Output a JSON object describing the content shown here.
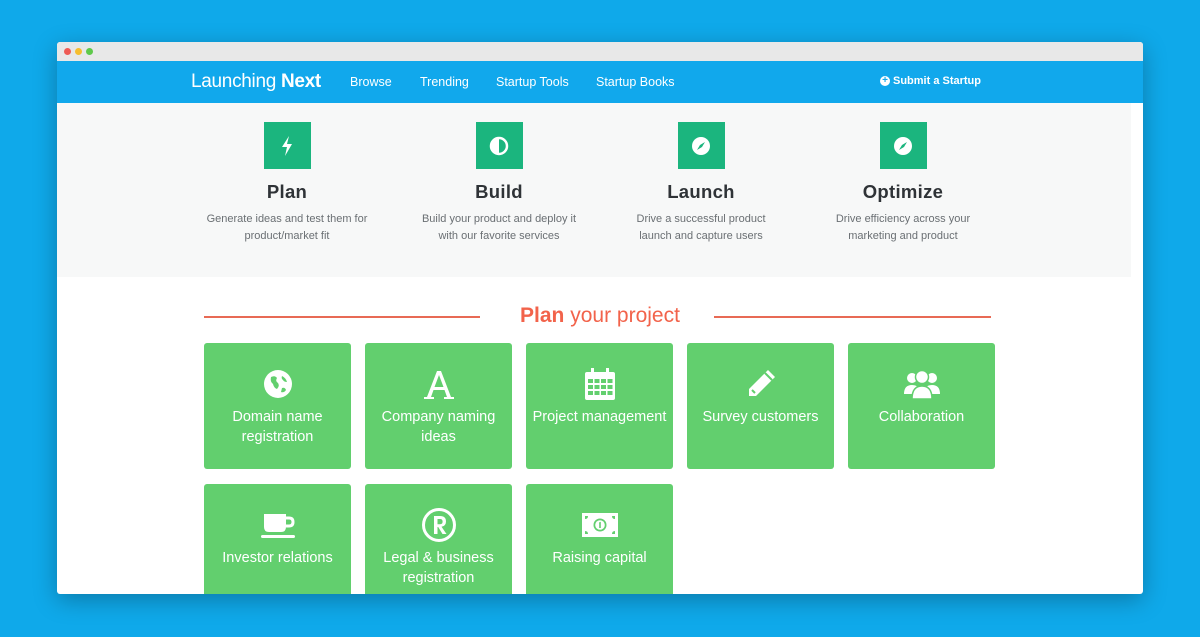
{
  "nav": {
    "logo_light": "Launching ",
    "logo_bold": "Next",
    "links": [
      "Browse",
      "Trending",
      "Startup Tools",
      "Startup Books"
    ],
    "submit": "Submit a Startup"
  },
  "phases": [
    {
      "title": "Plan",
      "desc_line1": "Generate ideas and test them for",
      "desc_line2": "product/market fit",
      "icon": "bolt-icon"
    },
    {
      "title": "Build",
      "desc_line1": "Build your product and deploy it",
      "desc_line2": "with our favorite services",
      "icon": "half-circle-icon"
    },
    {
      "title": "Launch",
      "desc_line1": "Drive a successful product",
      "desc_line2": "launch and capture users",
      "icon": "compass-icon"
    },
    {
      "title": "Optimize",
      "desc_line1": "Drive efficiency across your",
      "desc_line2": "marketing and product",
      "icon": "compass-icon"
    }
  ],
  "section": {
    "strong": "Plan",
    "rest": " your project"
  },
  "tiles": [
    {
      "line1": "Domain name",
      "line2": "registration",
      "icon": "globe-icon"
    },
    {
      "line1": "Company naming",
      "line2": "ideas",
      "icon": "font-icon"
    },
    {
      "line1": "Project management",
      "line2": "",
      "icon": "calendar-icon"
    },
    {
      "line1": "Survey customers",
      "line2": "",
      "icon": "pencil-icon"
    },
    {
      "line1": "Collaboration",
      "line2": "",
      "icon": "users-icon"
    },
    {
      "line1": "Investor relations",
      "line2": "",
      "icon": "coffee-cup-icon"
    },
    {
      "line1": "Legal & business",
      "line2": "registration",
      "icon": "registered-icon"
    },
    {
      "line1": "Raising capital",
      "line2": "",
      "icon": "money-icon"
    }
  ],
  "colors": {
    "brand_blue": "#11a8ec",
    "phase_green": "#1bb57e",
    "tile_green": "#62cf6e",
    "accent_red": "#f2634b"
  }
}
